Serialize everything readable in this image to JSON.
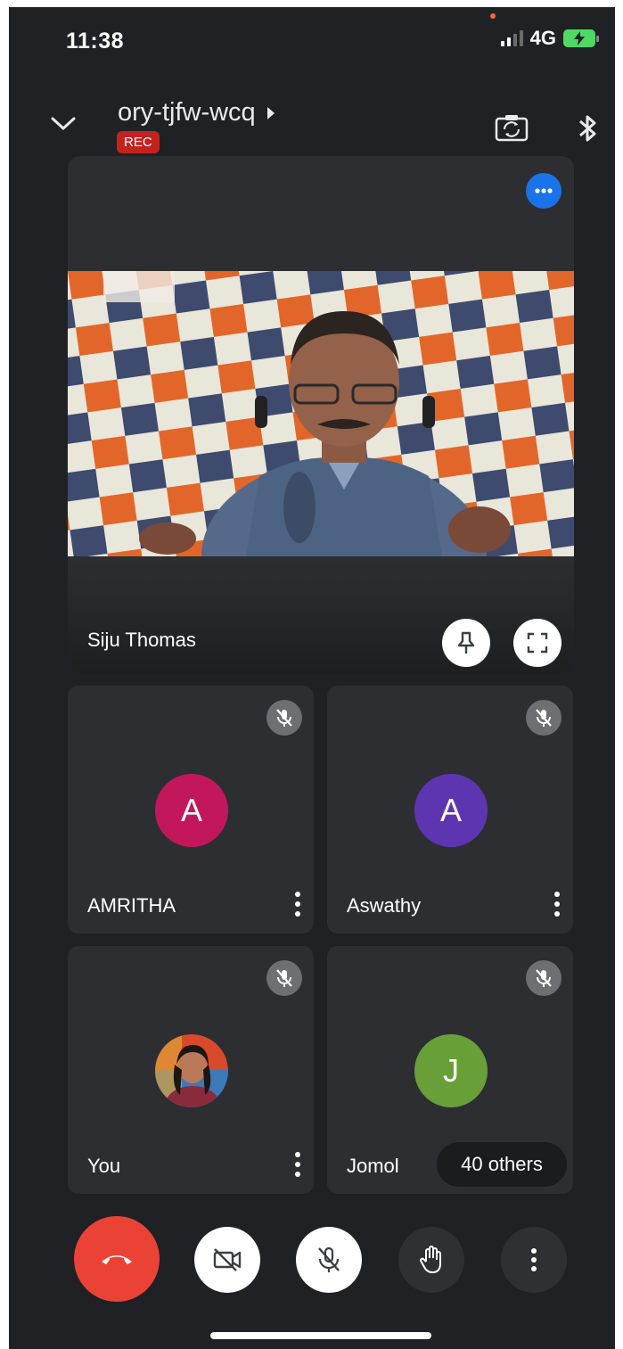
{
  "status_bar": {
    "time": "11:38",
    "network": "4G"
  },
  "header": {
    "meeting_code": "ory-tjfw-wcq",
    "rec_label": "REC"
  },
  "main_tile": {
    "name": "Siju Thomas"
  },
  "participants": [
    {
      "name": "AMRITHA",
      "initial": "A",
      "color": "#c2185b"
    },
    {
      "name": "Aswathy",
      "initial": "A",
      "color": "#5e35b1"
    },
    {
      "name": "You",
      "initial": ""
    },
    {
      "name": "Jomol",
      "initial": "J",
      "color": "#689f38",
      "others_label": "40 others"
    }
  ],
  "icons": {
    "back": "chevron-down-icon",
    "switch_camera": "switch-camera-icon",
    "bluetooth": "bluetooth-icon",
    "end_call": "end-call-icon",
    "camera_off": "camera-off-icon",
    "mic_off": "mic-off-icon",
    "raise_hand": "raise-hand-icon",
    "more": "more-vert-icon"
  }
}
